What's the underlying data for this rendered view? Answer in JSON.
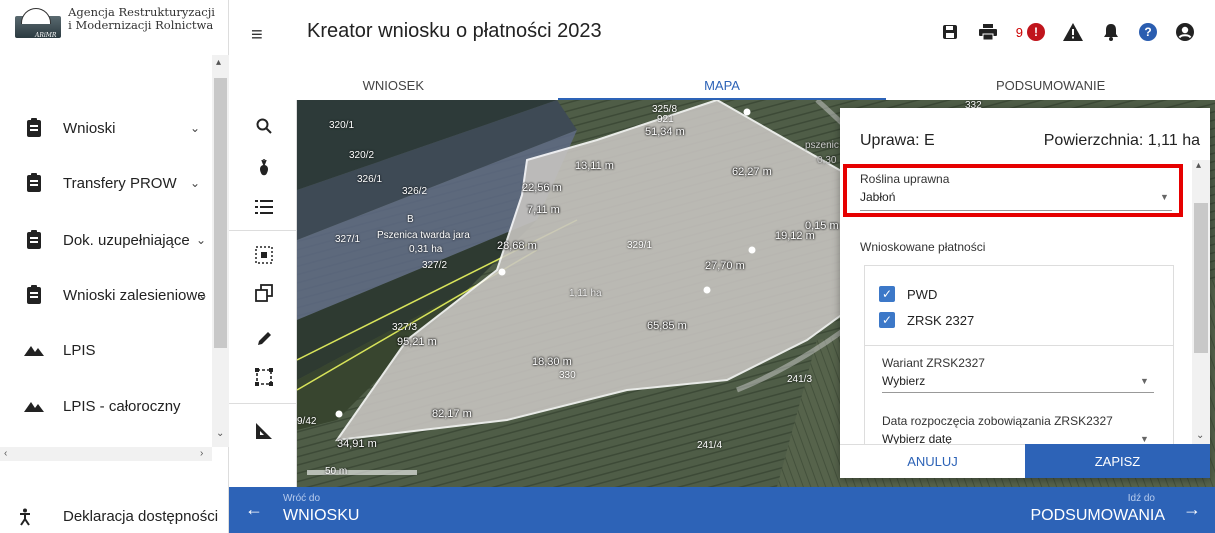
{
  "logo": {
    "line1": "Agencja Restrukturyzacji",
    "line2": "i Modernizacji Rolnictwa",
    "mark_text": "ARiMR"
  },
  "sidebar": {
    "items": [
      {
        "label": "Wnioski",
        "icon": "clipboard-icon",
        "has_chevron": true
      },
      {
        "label": "Transfery PROW",
        "icon": "clipboard-icon",
        "has_chevron": true
      },
      {
        "label": "Dok. uzupełniające",
        "icon": "clipboard-icon",
        "has_chevron": true
      },
      {
        "label": "Wnioski zalesieniowe",
        "icon": "clipboard-icon",
        "has_chevron": true
      },
      {
        "label": "LPIS",
        "icon": "mountains-icon",
        "has_chevron": false
      },
      {
        "label": "LPIS - całoroczny",
        "icon": "mountains-icon",
        "has_chevron": false
      }
    ],
    "chevron": "⌄",
    "footer_label": "Deklaracja dostępności"
  },
  "header": {
    "title": "Kreator wniosku o płatności 2023",
    "error_count": "9",
    "error_badge": "!",
    "help_badge": "?"
  },
  "tabs": [
    {
      "label": "WNIOSEK",
      "active": false
    },
    {
      "label": "MAPA",
      "active": true
    },
    {
      "label": "PODSUMOWANIE",
      "active": false
    }
  ],
  "map": {
    "parcel_labels": [
      "320/1",
      "320/2",
      "326/1",
      "326/2",
      "327/1",
      "327/2",
      "327/3",
      "329/1",
      "330",
      "241/3",
      "241/4",
      "325/8",
      "921",
      "332",
      "9/42"
    ],
    "lengths": [
      "51,34 m",
      "13,11 m",
      "22,56 m",
      "7,11 m",
      "28,68 m",
      "62,27 m",
      "19,12 m",
      "0,15 m",
      "27,70 m",
      "65,85 m",
      "95,21 m",
      "18,30 m",
      "82,17 m",
      "34,91 m"
    ],
    "field_b_label": "B",
    "field_b_crop": "Pszenica twarda jara",
    "field_b_area": "0,31 ha",
    "field_e_area": "1,11 ha",
    "right_label": "pszenic",
    "right_value": "0,30",
    "scale_label": "50 m"
  },
  "dialog": {
    "crop_title": "Uprawa: E",
    "area_title": "Powierzchnia: 1,11 ha",
    "plant_label": "Roślina uprawna",
    "plant_value": "Jabłoń",
    "payments_label": "Wnioskowane płatności",
    "payments": [
      {
        "label": "PWD",
        "checked": true
      },
      {
        "label": "ZRSK 2327",
        "checked": true
      }
    ],
    "variant_label": "Wariant ZRSK2327",
    "variant_value": "Wybierz",
    "date_label": "Data rozpoczęcia zobowiązania ZRSK2327",
    "date_value": "Wybierz datę",
    "cancel": "ANULUJ",
    "save": "ZAPISZ"
  },
  "bottom": {
    "back_small": "Wróć do",
    "back_big": "WNIOSKU",
    "next_small": "Idź do",
    "next_big": "PODSUMOWANIA"
  },
  "colors": {
    "accent": "#2d63b7",
    "error": "#c0141c",
    "highlight": "#e60000"
  }
}
